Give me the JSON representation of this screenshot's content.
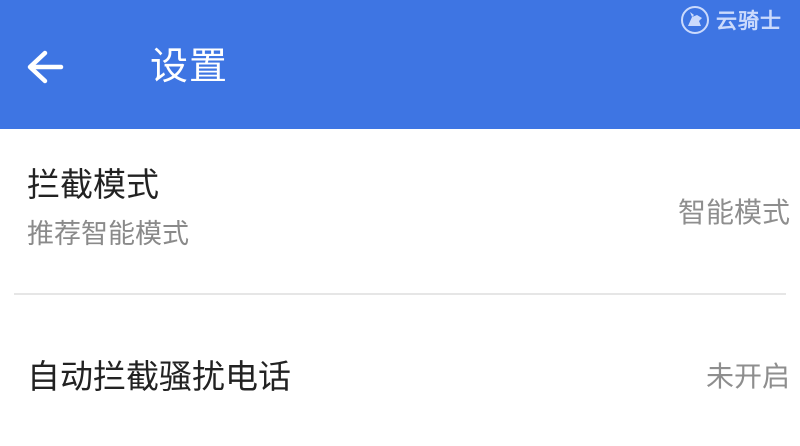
{
  "header": {
    "title": "设置",
    "watermark_text": "云骑士",
    "background_color": "#3e75e3"
  },
  "settings": [
    {
      "title": "拦截模式",
      "subtitle": "推荐智能模式",
      "value": "智能模式"
    },
    {
      "title": "自动拦截骚扰电话",
      "value": "未开启"
    }
  ]
}
